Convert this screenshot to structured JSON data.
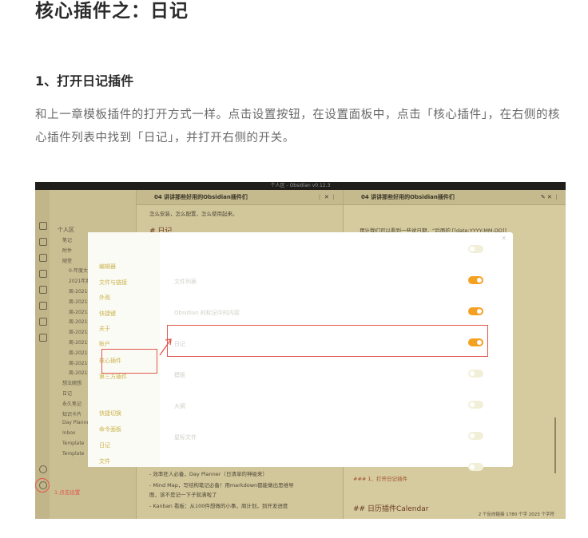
{
  "article": {
    "title": "核心插件之：日记",
    "section_heading": "1、打开日记插件",
    "paragraph": "和上一章模板插件的打开方式一样。点击设置按钮，在设置面板中，点击「核心插件」，在右侧的核心插件列表中找到「日记」，并打开右侧的开关。"
  },
  "screenshot": {
    "window_title": "个人区 - Obsidian v0.12.3",
    "vault_name": "个人区",
    "file_tree": [
      "笔记",
      "附件",
      "随堂",
      "0-年度大事",
      "2021年度复盘",
      "周-2021年",
      "周-2021年",
      "周-2021年",
      "周-2021年",
      "周-2021年",
      "周-2021年",
      "周-2021年",
      "周-2021年",
      "周-2021年",
      "想法随想",
      "日记",
      "永久笔记",
      "知识卡片",
      "Day Planner",
      "Inbox",
      "Template",
      "Template"
    ],
    "left_tab_title": "04 讲讲那些好用的Obsidian插件们",
    "right_tab_title": "04 讲讲那些好用的Obsidian插件们",
    "left_editor_lines": [
      "怎么安装，怎么配置，怎么使用起来。",
      "# 日记",
      "- 效率狂人必备，Day Planner（日清单的神级来）",
      "- Mind Map，写结构笔记必备！用markdown都能做出思维导",
      "图，该不是记一下子就满啦了",
      "- Kanban 看板：从100件想做的小事，周计划，到开发进度"
    ],
    "right_editor_lines": [
      "用计我们可以看到一些说日期，“后面的 [[date:YYYY-MM-DD]]",
      "### 1、打开日记插件",
      "## 日历插件Calendar"
    ],
    "status_bar": "2 个反向链接    1780 个字  2023 个字符",
    "settings_nav": [
      "编辑器",
      "文件与链接",
      "外观",
      "快捷键",
      "关于",
      "账户",
      "核心插件",
      "第三方插件",
      "快捷切换",
      "命令面板",
      "日记",
      "文件"
    ],
    "plugin_rows": [
      {
        "label": "",
        "on": false
      },
      {
        "label": "文件列表",
        "on": true
      },
      {
        "label": "Obsidian 的标记中的内容",
        "on": true
      },
      {
        "label": "日记",
        "on": true
      },
      {
        "label": "模板",
        "on": false
      },
      {
        "label": "大纲",
        "on": false
      },
      {
        "label": "星标文件",
        "on": false
      },
      {
        "label": "",
        "on": false
      }
    ],
    "annotation_label": "1.点击设置"
  },
  "colors": {
    "accent": "#f4a021",
    "annotation": "#e2554a"
  }
}
